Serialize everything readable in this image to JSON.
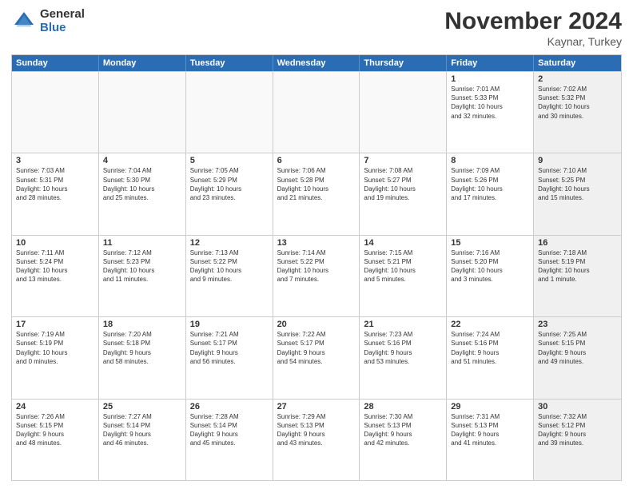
{
  "header": {
    "logo_general": "General",
    "logo_blue": "Blue",
    "month_title": "November 2024",
    "location": "Kaynar, Turkey"
  },
  "weekdays": [
    "Sunday",
    "Monday",
    "Tuesday",
    "Wednesday",
    "Thursday",
    "Friday",
    "Saturday"
  ],
  "rows": [
    [
      {
        "day": "",
        "info": "",
        "shaded": false,
        "empty": true
      },
      {
        "day": "",
        "info": "",
        "shaded": false,
        "empty": true
      },
      {
        "day": "",
        "info": "",
        "shaded": false,
        "empty": true
      },
      {
        "day": "",
        "info": "",
        "shaded": false,
        "empty": true
      },
      {
        "day": "",
        "info": "",
        "shaded": false,
        "empty": true
      },
      {
        "day": "1",
        "info": "Sunrise: 7:01 AM\nSunset: 5:33 PM\nDaylight: 10 hours\nand 32 minutes.",
        "shaded": false,
        "empty": false
      },
      {
        "day": "2",
        "info": "Sunrise: 7:02 AM\nSunset: 5:32 PM\nDaylight: 10 hours\nand 30 minutes.",
        "shaded": true,
        "empty": false
      }
    ],
    [
      {
        "day": "3",
        "info": "Sunrise: 7:03 AM\nSunset: 5:31 PM\nDaylight: 10 hours\nand 28 minutes.",
        "shaded": false,
        "empty": false
      },
      {
        "day": "4",
        "info": "Sunrise: 7:04 AM\nSunset: 5:30 PM\nDaylight: 10 hours\nand 25 minutes.",
        "shaded": false,
        "empty": false
      },
      {
        "day": "5",
        "info": "Sunrise: 7:05 AM\nSunset: 5:29 PM\nDaylight: 10 hours\nand 23 minutes.",
        "shaded": false,
        "empty": false
      },
      {
        "day": "6",
        "info": "Sunrise: 7:06 AM\nSunset: 5:28 PM\nDaylight: 10 hours\nand 21 minutes.",
        "shaded": false,
        "empty": false
      },
      {
        "day": "7",
        "info": "Sunrise: 7:08 AM\nSunset: 5:27 PM\nDaylight: 10 hours\nand 19 minutes.",
        "shaded": false,
        "empty": false
      },
      {
        "day": "8",
        "info": "Sunrise: 7:09 AM\nSunset: 5:26 PM\nDaylight: 10 hours\nand 17 minutes.",
        "shaded": false,
        "empty": false
      },
      {
        "day": "9",
        "info": "Sunrise: 7:10 AM\nSunset: 5:25 PM\nDaylight: 10 hours\nand 15 minutes.",
        "shaded": true,
        "empty": false
      }
    ],
    [
      {
        "day": "10",
        "info": "Sunrise: 7:11 AM\nSunset: 5:24 PM\nDaylight: 10 hours\nand 13 minutes.",
        "shaded": false,
        "empty": false
      },
      {
        "day": "11",
        "info": "Sunrise: 7:12 AM\nSunset: 5:23 PM\nDaylight: 10 hours\nand 11 minutes.",
        "shaded": false,
        "empty": false
      },
      {
        "day": "12",
        "info": "Sunrise: 7:13 AM\nSunset: 5:22 PM\nDaylight: 10 hours\nand 9 minutes.",
        "shaded": false,
        "empty": false
      },
      {
        "day": "13",
        "info": "Sunrise: 7:14 AM\nSunset: 5:22 PM\nDaylight: 10 hours\nand 7 minutes.",
        "shaded": false,
        "empty": false
      },
      {
        "day": "14",
        "info": "Sunrise: 7:15 AM\nSunset: 5:21 PM\nDaylight: 10 hours\nand 5 minutes.",
        "shaded": false,
        "empty": false
      },
      {
        "day": "15",
        "info": "Sunrise: 7:16 AM\nSunset: 5:20 PM\nDaylight: 10 hours\nand 3 minutes.",
        "shaded": false,
        "empty": false
      },
      {
        "day": "16",
        "info": "Sunrise: 7:18 AM\nSunset: 5:19 PM\nDaylight: 10 hours\nand 1 minute.",
        "shaded": true,
        "empty": false
      }
    ],
    [
      {
        "day": "17",
        "info": "Sunrise: 7:19 AM\nSunset: 5:19 PM\nDaylight: 10 hours\nand 0 minutes.",
        "shaded": false,
        "empty": false
      },
      {
        "day": "18",
        "info": "Sunrise: 7:20 AM\nSunset: 5:18 PM\nDaylight: 9 hours\nand 58 minutes.",
        "shaded": false,
        "empty": false
      },
      {
        "day": "19",
        "info": "Sunrise: 7:21 AM\nSunset: 5:17 PM\nDaylight: 9 hours\nand 56 minutes.",
        "shaded": false,
        "empty": false
      },
      {
        "day": "20",
        "info": "Sunrise: 7:22 AM\nSunset: 5:17 PM\nDaylight: 9 hours\nand 54 minutes.",
        "shaded": false,
        "empty": false
      },
      {
        "day": "21",
        "info": "Sunrise: 7:23 AM\nSunset: 5:16 PM\nDaylight: 9 hours\nand 53 minutes.",
        "shaded": false,
        "empty": false
      },
      {
        "day": "22",
        "info": "Sunrise: 7:24 AM\nSunset: 5:16 PM\nDaylight: 9 hours\nand 51 minutes.",
        "shaded": false,
        "empty": false
      },
      {
        "day": "23",
        "info": "Sunrise: 7:25 AM\nSunset: 5:15 PM\nDaylight: 9 hours\nand 49 minutes.",
        "shaded": true,
        "empty": false
      }
    ],
    [
      {
        "day": "24",
        "info": "Sunrise: 7:26 AM\nSunset: 5:15 PM\nDaylight: 9 hours\nand 48 minutes.",
        "shaded": false,
        "empty": false
      },
      {
        "day": "25",
        "info": "Sunrise: 7:27 AM\nSunset: 5:14 PM\nDaylight: 9 hours\nand 46 minutes.",
        "shaded": false,
        "empty": false
      },
      {
        "day": "26",
        "info": "Sunrise: 7:28 AM\nSunset: 5:14 PM\nDaylight: 9 hours\nand 45 minutes.",
        "shaded": false,
        "empty": false
      },
      {
        "day": "27",
        "info": "Sunrise: 7:29 AM\nSunset: 5:13 PM\nDaylight: 9 hours\nand 43 minutes.",
        "shaded": false,
        "empty": false
      },
      {
        "day": "28",
        "info": "Sunrise: 7:30 AM\nSunset: 5:13 PM\nDaylight: 9 hours\nand 42 minutes.",
        "shaded": false,
        "empty": false
      },
      {
        "day": "29",
        "info": "Sunrise: 7:31 AM\nSunset: 5:13 PM\nDaylight: 9 hours\nand 41 minutes.",
        "shaded": false,
        "empty": false
      },
      {
        "day": "30",
        "info": "Sunrise: 7:32 AM\nSunset: 5:12 PM\nDaylight: 9 hours\nand 39 minutes.",
        "shaded": true,
        "empty": false
      }
    ]
  ]
}
